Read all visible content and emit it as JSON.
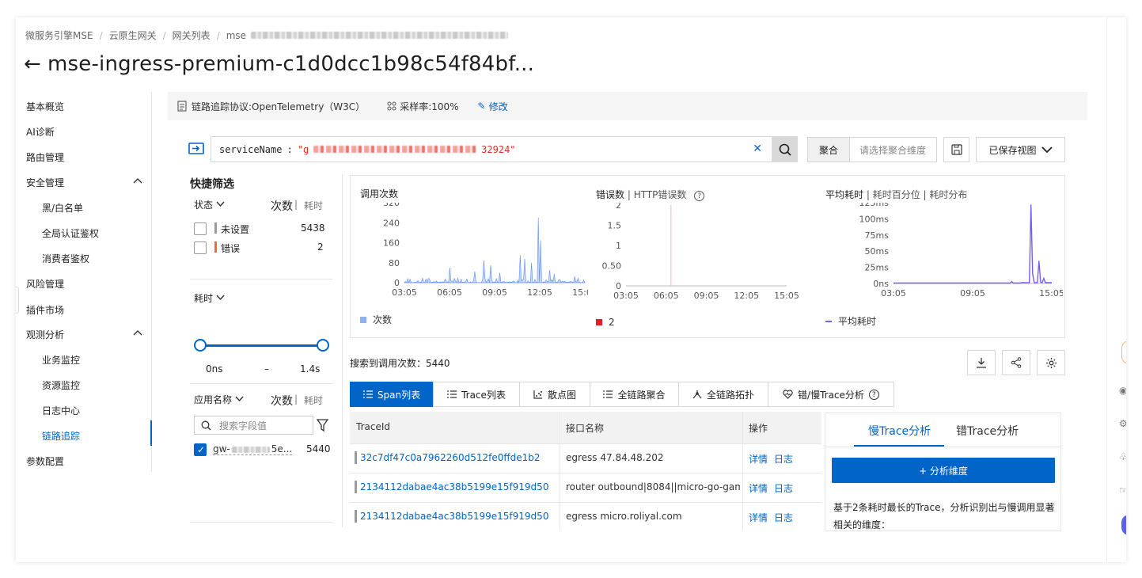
{
  "breadcrumb": [
    "微服务引擎MSE",
    "云原生网关",
    "网关列表",
    "mse"
  ],
  "page_title": "mse-ingress-premium-c1d0dcc1b98c54f84bf...",
  "sidebar": {
    "items": [
      {
        "label": "基本概览"
      },
      {
        "label": "AI诊断"
      },
      {
        "label": "路由管理"
      },
      {
        "label": "安全管理"
      },
      {
        "label": "黑/白名单"
      },
      {
        "label": "全局认证鉴权"
      },
      {
        "label": "消费者鉴权"
      },
      {
        "label": "风险管理"
      },
      {
        "label": "插件市场"
      },
      {
        "label": "观测分析"
      },
      {
        "label": "业务监控"
      },
      {
        "label": "资源监控"
      },
      {
        "label": "日志中心"
      },
      {
        "label": "链路追踪"
      },
      {
        "label": "参数配置"
      }
    ],
    "active": "链路追踪"
  },
  "protocol_bar": {
    "protocol": "链路追踪协议:OpenTelemetry（W3C）",
    "sampling": "采样率:100%",
    "edit": "修改"
  },
  "query": {
    "key": "serviceName",
    "op": ":",
    "value_prefix": "\"g",
    "value_suffix": "32924\""
  },
  "toolbar": {
    "aggregate_label": "聚合",
    "aggregate_placeholder": "请选择聚合维度",
    "saved_views": "已保存视图"
  },
  "quick_filter": {
    "title": "快捷筛选",
    "status_label": "状态",
    "count_label": "次数",
    "duration_label": "耗时",
    "status_items": [
      {
        "label": "未设置",
        "count": "5438",
        "color": "#9a9a9a"
      },
      {
        "label": "错误",
        "count": "2",
        "color": "#f06a2b"
      }
    ],
    "duration_section": "耗时",
    "range_min": "0ns",
    "range_sep": "–",
    "range_max": "1.4s",
    "app_label": "应用名称",
    "search_placeholder": "搜索字段值",
    "app_items": [
      {
        "label": "gw-",
        "label_suffix": "5e...",
        "count": "5440",
        "checked": true
      }
    ]
  },
  "charts": [
    {
      "title": "调用次数",
      "type": "area",
      "y_ticks": [
        "320",
        "240",
        "160",
        "80",
        "0"
      ],
      "x_ticks": [
        "03:05",
        "06:05",
        "09:05",
        "12:05",
        "15:05"
      ],
      "legend": "次数",
      "color": "#5b8ff9"
    },
    {
      "title": "错误数",
      "title_alt": "HTTP错误数",
      "type": "bar",
      "y_ticks": [
        "2",
        "1.5",
        "1",
        "0.50",
        "0"
      ],
      "x_ticks": [
        "03:05",
        "06:05",
        "09:05",
        "12:05",
        "15:05"
      ],
      "legend": "2",
      "color": "#e02020"
    },
    {
      "title": "平均耗时",
      "title_alt1": "耗时百分位",
      "title_alt2": "耗时分布",
      "type": "line",
      "y_ticks": [
        "125ms",
        "100ms",
        "75ms",
        "50ms",
        "25ms",
        "0ns"
      ],
      "x_ticks": [
        "03:05",
        "09:05",
        "15:05"
      ],
      "legend": "平均耗时",
      "color": "#7b5cf0"
    }
  ],
  "chart_data": [
    {
      "type": "area",
      "title": "调用次数",
      "x": [
        "03:05",
        "06:05",
        "09:05",
        "12:05",
        "15:05"
      ],
      "ylim": [
        0,
        320
      ],
      "series": [
        {
          "name": "次数",
          "values": [
            5,
            45,
            90,
            260,
            40
          ]
        }
      ]
    },
    {
      "type": "bar",
      "title": "错误数",
      "x": [
        "03:05",
        "06:05",
        "09:05",
        "12:05",
        "15:05"
      ],
      "ylim": [
        0,
        2
      ],
      "series": [
        {
          "name": "2",
          "values": [
            0,
            2,
            0,
            0,
            0
          ]
        }
      ]
    },
    {
      "type": "line",
      "title": "平均耗时",
      "x": [
        "03:05",
        "09:05",
        "15:05"
      ],
      "ylim": [
        0,
        125
      ],
      "series": [
        {
          "name": "平均耗时",
          "values": [
            0,
            1,
            120
          ]
        }
      ]
    }
  ],
  "results": {
    "count_text": "搜索到调用次数：5440"
  },
  "view_tabs": [
    "Span列表",
    "Trace列表",
    "散点图",
    "全链路聚合",
    "全链路拓扑",
    "错/慢Trace分析"
  ],
  "table": {
    "headers": [
      "TraceId",
      "接口名称",
      "操作"
    ],
    "rows": [
      {
        "trace_id": "32c7df47c0a7962260d512fe0ffde1b2",
        "api": "egress 47.84.48.202",
        "detail": "详情",
        "log": "日志"
      },
      {
        "trace_id": "2134112dabae4ac38b5199e15f919d50",
        "api": "router outbound|8084||micro-go-game...",
        "detail": "详情",
        "log": "日志"
      },
      {
        "trace_id": "2134112dabae4ac38b5199e15f919d50",
        "api": "egress micro.roliyal.com",
        "detail": "详情",
        "log": "日志"
      }
    ]
  },
  "analysis": {
    "tab_slow": "慢Trace分析",
    "tab_error": "错Trace分析",
    "button": "+ 分析维度",
    "text": "基于2条耗时最长的Trace，分析识别出与慢调用显著相关的维度："
  }
}
